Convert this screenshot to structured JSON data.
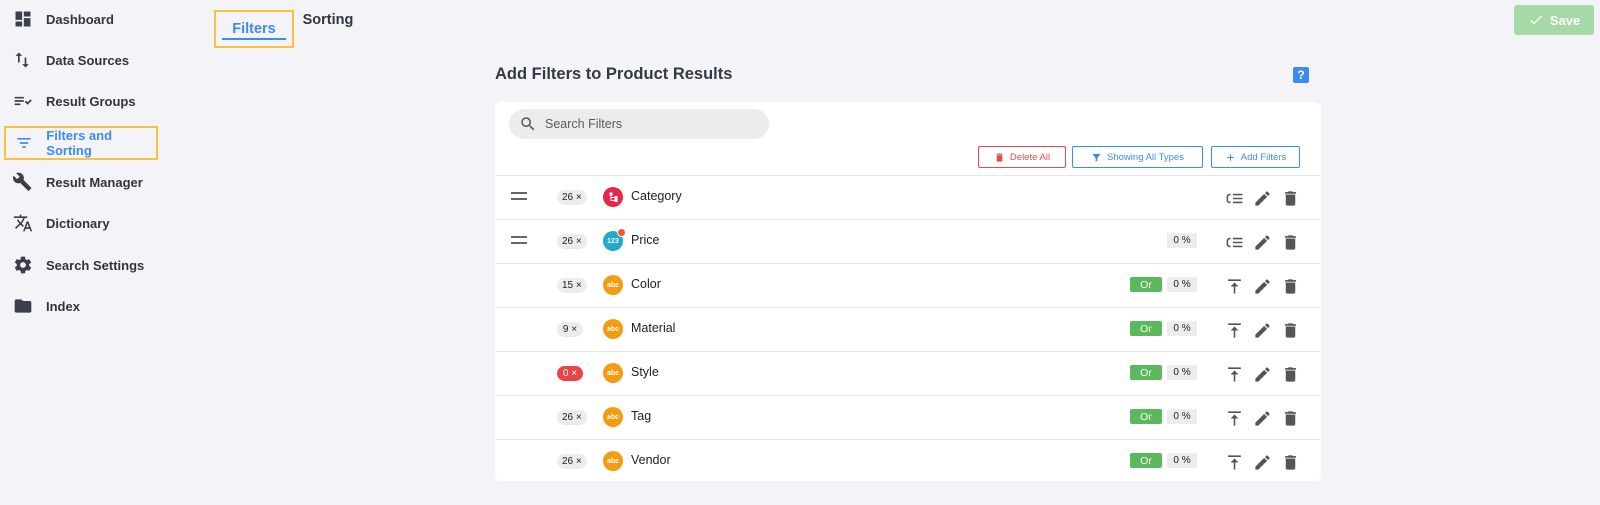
{
  "sidebar": {
    "items": [
      {
        "label": "Dashboard",
        "icon": "dashboard-icon"
      },
      {
        "label": "Data Sources",
        "icon": "arrows-up-down-icon"
      },
      {
        "label": "Result Groups",
        "icon": "list-check-icon"
      },
      {
        "label": "Filters and Sorting",
        "icon": "filter-lines-icon",
        "active": true
      },
      {
        "label": "Result Manager",
        "icon": "tools-icon"
      },
      {
        "label": "Dictionary",
        "icon": "translate-icon"
      },
      {
        "label": "Search Settings",
        "icon": "gear-icon"
      },
      {
        "label": "Index",
        "icon": "folder-icon"
      }
    ]
  },
  "tabs": {
    "filters": "Filters",
    "sorting": "Sorting"
  },
  "toolbar": {
    "save_label": "Save"
  },
  "main": {
    "title": "Add Filters to Product Results",
    "help": "?",
    "search_placeholder": "Search Filters",
    "delete_all": "Delete All",
    "showing_types": "Showing All Types",
    "add_filters": "Add Filters"
  },
  "filters": [
    {
      "count": "26 ×",
      "name": "Category",
      "type": "category",
      "icon_text": "",
      "or": "",
      "pct": ""
    },
    {
      "count": "26 ×",
      "name": "Price",
      "type": "number",
      "icon_text": "123",
      "or": "",
      "pct": "0 %"
    },
    {
      "count": "15 ×",
      "name": "Color",
      "type": "string",
      "icon_text": "abc",
      "or": "Or",
      "pct": "0 %"
    },
    {
      "count": "9 ×",
      "name": "Material",
      "type": "string",
      "icon_text": "abc",
      "or": "Or",
      "pct": "0 %"
    },
    {
      "count": "0 ×",
      "name": "Style",
      "type": "string",
      "icon_text": "abc",
      "or": "Or",
      "pct": "0 %"
    },
    {
      "count": "26 ×",
      "name": "Tag",
      "type": "string",
      "icon_text": "abc",
      "or": "Or",
      "pct": "0 %"
    },
    {
      "count": "26 ×",
      "name": "Vendor",
      "type": "string",
      "icon_text": "abc",
      "or": "Or",
      "pct": "0 %"
    }
  ],
  "colors": {
    "accent": "#3d8bf0",
    "highlight": "#f7c33c",
    "danger": "#e64a4a",
    "success": "#5cb85c",
    "save_disabled": "#a6d9a8"
  }
}
